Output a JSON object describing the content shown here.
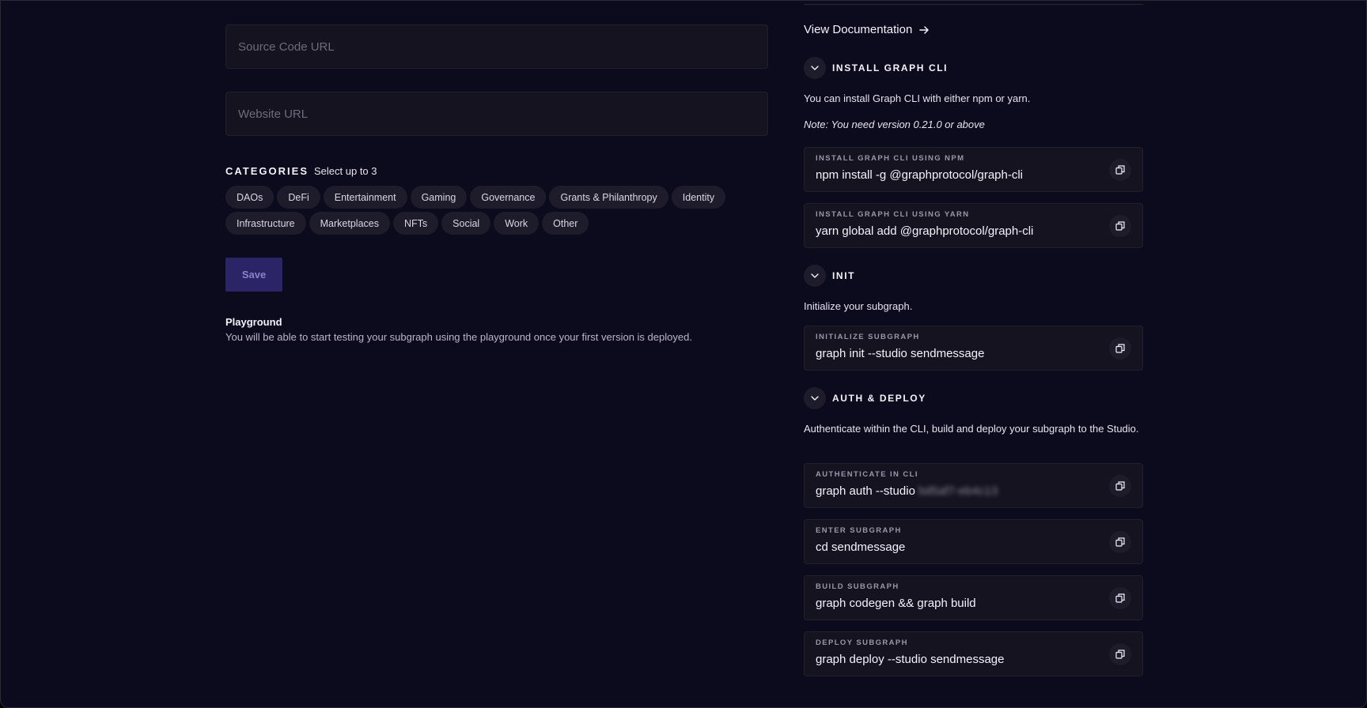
{
  "form": {
    "source_code_placeholder": "Source Code URL",
    "website_placeholder": "Website URL",
    "categories_title": "CATEGORIES",
    "categories_hint": "Select up to 3",
    "categories": [
      "DAOs",
      "DeFi",
      "Entertainment",
      "Gaming",
      "Governance",
      "Grants & Philanthropy",
      "Identity",
      "Infrastructure",
      "Marketplaces",
      "NFTs",
      "Social",
      "Work",
      "Other"
    ],
    "save_label": "Save",
    "playground_title": "Playground",
    "playground_text": "You will be able to start testing your subgraph using the playground once your first version is deployed."
  },
  "sidebar": {
    "doc_link": "View Documentation",
    "install": {
      "title": "INSTALL GRAPH CLI",
      "desc": "You can install Graph CLI with either npm or yarn.",
      "note": "Note: You need version 0.21.0 or above",
      "npm_label": "INSTALL GRAPH CLI USING NPM",
      "npm_cmd": "npm install -g @graphprotocol/graph-cli",
      "yarn_label": "INSTALL GRAPH CLI USING YARN",
      "yarn_cmd": "yarn global add @graphprotocol/graph-cli"
    },
    "init": {
      "title": "INIT",
      "desc": "Initialize your subgraph.",
      "label": "INITIALIZE SUBGRAPH",
      "cmd": "graph init --studio sendmessage"
    },
    "deploy": {
      "title": "AUTH & DEPLOY",
      "desc": "Authenticate within the CLI, build and deploy your subgraph to the Studio.",
      "auth_label": "AUTHENTICATE IN CLI",
      "auth_cmd": "graph auth --studio",
      "auth_key": "bd5af7-eb4c13",
      "enter_label": "ENTER SUBGRAPH",
      "enter_cmd": "cd sendmessage",
      "build_label": "BUILD SUBGRAPH",
      "build_cmd": "graph codegen && graph build",
      "deploy_label": "DEPLOY SUBGRAPH",
      "deploy_cmd": "graph deploy --studio sendmessage"
    }
  },
  "colors": {
    "background": "#0c0a1d",
    "field": "#15131f",
    "chip": "#1e1c2b",
    "save_button": "#2b2466"
  }
}
